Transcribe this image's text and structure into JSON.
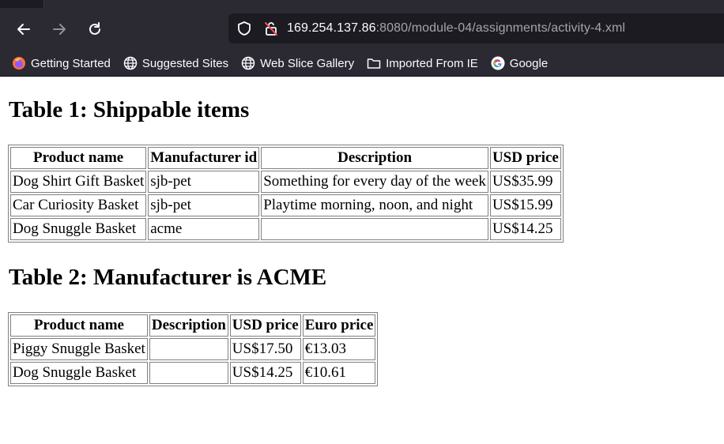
{
  "browser": {
    "url_host": "169.254.137.86",
    "url_rest": ":8080/module-04/assignments/activity-4.xml",
    "bookmarks": [
      {
        "label": "Getting Started",
        "icon": "firefox-icon"
      },
      {
        "label": "Suggested Sites",
        "icon": "globe-icon"
      },
      {
        "label": "Web Slice Gallery",
        "icon": "globe-icon"
      },
      {
        "label": "Imported From IE",
        "icon": "folder-icon"
      },
      {
        "label": "Google",
        "icon": "google-icon"
      }
    ]
  },
  "table1": {
    "title": "Table 1: Shippable items",
    "headers": [
      "Product name",
      "Manufacturer id",
      "Description",
      "USD price"
    ],
    "rows": [
      [
        "Dog Shirt Gift Basket",
        "sjb-pet",
        "Something for every day of the week",
        "US$35.99"
      ],
      [
        "Car Curiosity Basket",
        "sjb-pet",
        "Playtime morning, noon, and night",
        "US$15.99"
      ],
      [
        "Dog Snuggle Basket",
        "acme",
        "",
        "US$14.25"
      ]
    ]
  },
  "table2": {
    "title": "Table 2: Manufacturer is ACME",
    "headers": [
      "Product name",
      "Description",
      "USD price",
      "Euro price"
    ],
    "rows": [
      [
        "Piggy Snuggle Basket",
        "",
        "US$17.50",
        "€13.03"
      ],
      [
        "Dog Snuggle Basket",
        "",
        "US$14.25",
        "€10.61"
      ]
    ]
  }
}
